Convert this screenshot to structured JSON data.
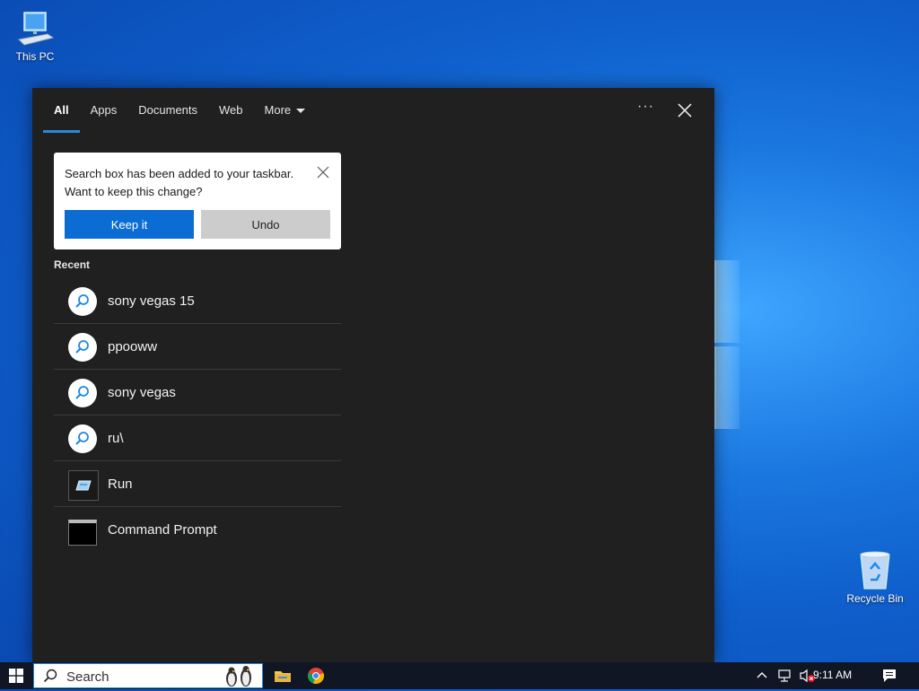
{
  "desktop": {
    "this_pc_label": "This PC",
    "recycle_bin_label": "Recycle Bin"
  },
  "flyout": {
    "tabs": [
      {
        "label": "All",
        "active": true
      },
      {
        "label": "Apps"
      },
      {
        "label": "Documents"
      },
      {
        "label": "Web"
      },
      {
        "label": "More"
      }
    ],
    "more_options_label": "···",
    "tip": {
      "line1": "Search box has been added to your taskbar.",
      "line2": "Want to keep this change?",
      "keep_label": "Keep it",
      "undo_label": "Undo"
    },
    "recent_label": "Recent",
    "recent_items": [
      {
        "label": "sony vegas 15",
        "icon": "search-icon"
      },
      {
        "label": "ppooww",
        "icon": "search-icon"
      },
      {
        "label": "sony vegas",
        "icon": "search-icon"
      },
      {
        "label": "ru\\",
        "icon": "search-icon"
      },
      {
        "label": "Run",
        "icon": "run-app-icon"
      },
      {
        "label": "Command Prompt",
        "icon": "command-prompt-icon"
      }
    ]
  },
  "taskbar": {
    "search_placeholder": "Search",
    "clock": "9:11 AM"
  },
  "colors": {
    "accent": "#0b6cd3",
    "flyout_bg": "#202020",
    "taskbar_bg": "#101623"
  }
}
